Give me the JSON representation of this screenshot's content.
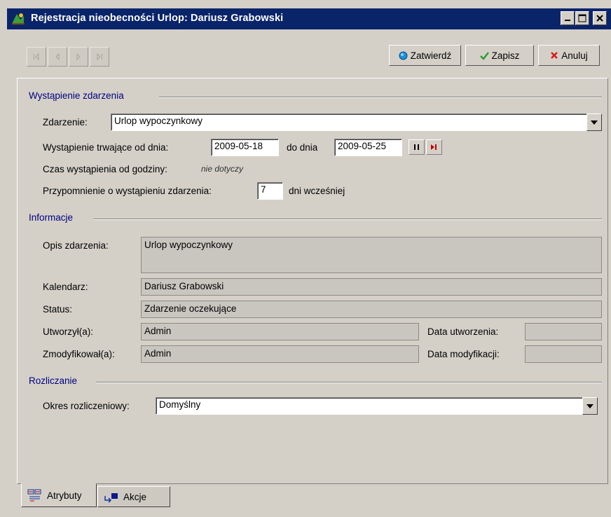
{
  "window": {
    "title": "Rejestracja nieobecności Urlop: Dariusz Grabowski"
  },
  "toolbar": {
    "nav_buttons": [
      "first",
      "previous",
      "next",
      "last"
    ],
    "confirm_label": "Zatwierdź",
    "save_label": "Zapisz",
    "cancel_label": "Anuluj",
    "colors": {
      "confirm": "#1a8fd8",
      "save": "#2a9d2a",
      "cancel": "#d81818"
    }
  },
  "occurrence": {
    "section_title": "Wystąpienie zdarzenia",
    "event_label": "Zdarzenie:",
    "event_value": "Urlop wypoczynkowy",
    "from_label": "Wystąpienie trwające od dnia:",
    "from_value": "2009-05-18",
    "to_label": "do dnia",
    "to_value": "2009-05-25",
    "time_label": "Czas wystąpienia od godziny:",
    "time_value": "nie dotyczy",
    "reminder_label": "Przypomnienie o wystąpieniu zdarzenia:",
    "reminder_value": "7",
    "reminder_suffix": "dni wcześniej"
  },
  "info": {
    "section_title": "Informacje",
    "desc_label": "Opis zdarzenia:",
    "desc_value": "Urlop wypoczynkowy",
    "calendar_label": "Kalendarz:",
    "calendar_value": "Dariusz Grabowski",
    "status_label": "Status:",
    "status_value": "Zdarzenie oczekujące",
    "created_by_label": "Utworzył(a):",
    "created_by_value": "Admin",
    "created_date_label": "Data utworzenia:",
    "created_date_value": "",
    "modified_by_label": "Zmodyfikował(a):",
    "modified_by_value": "Admin",
    "modified_date_label": "Data modyfikacji:",
    "modified_date_value": ""
  },
  "settlement": {
    "section_title": "Rozliczanie",
    "period_label": "Okres rozliczeniowy:",
    "period_value": "Domyślny"
  },
  "tabs": [
    {
      "label": "Atrybuty",
      "icon": "attributes-icon",
      "active": true
    },
    {
      "label": "Akcje",
      "icon": "actions-icon",
      "active": false
    }
  ]
}
